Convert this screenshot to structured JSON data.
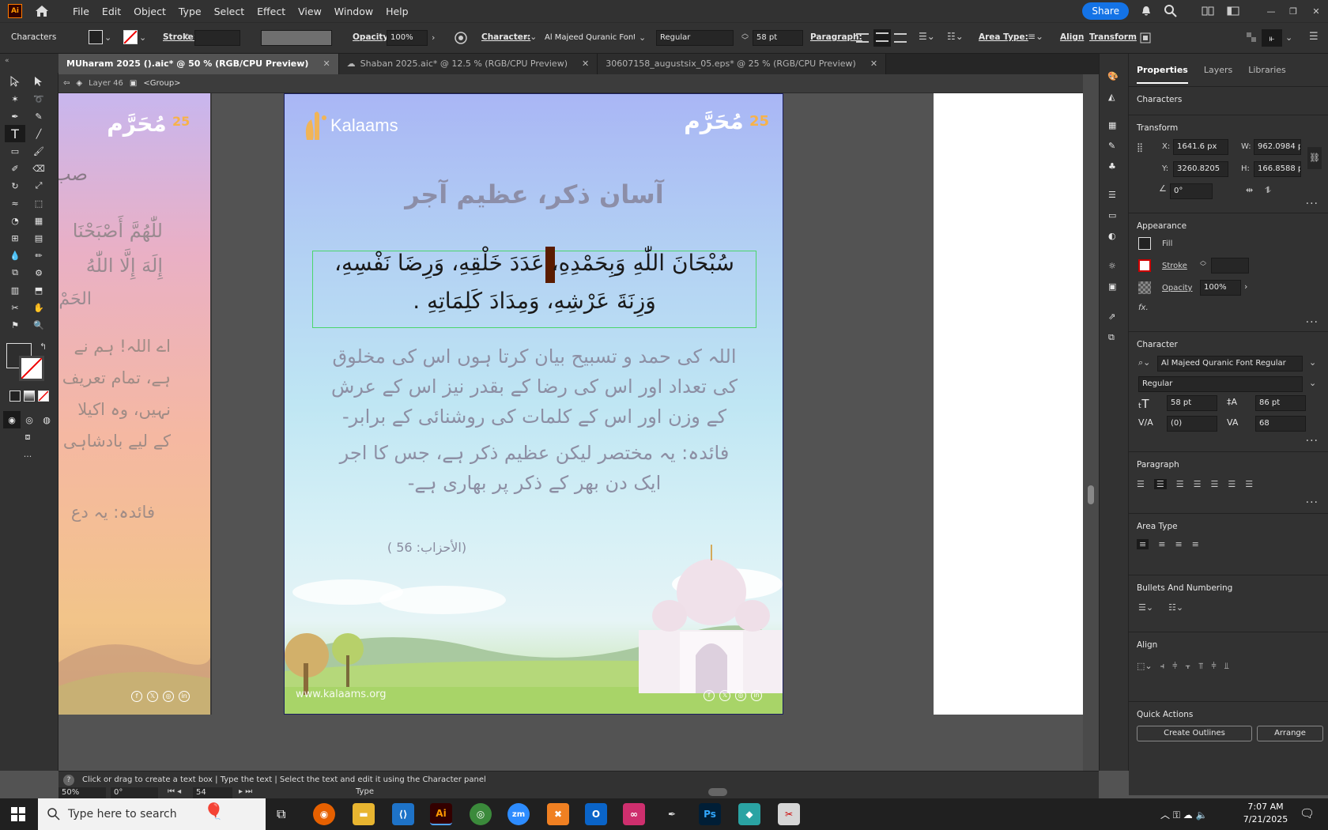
{
  "menubar": {
    "app_logo": "Ai",
    "items": [
      "File",
      "Edit",
      "Object",
      "Type",
      "Select",
      "Effect",
      "View",
      "Window",
      "Help"
    ],
    "share_label": "Share"
  },
  "control": {
    "panel_name": "Characters",
    "stroke_label": "Stroke:",
    "opacity_label": "Opacity:",
    "opacity_value": "100%",
    "character_label": "Character:",
    "font_name": "Al Majeed Quranic Font...",
    "font_style": "Regular",
    "font_size": "58 pt",
    "paragraph_label": "Paragraph:",
    "area_type_label": "Area Type:",
    "align_label": "Align",
    "transform_label": "Transform"
  },
  "tabs": [
    {
      "label": "MUharam 2025 ().aic* @ 50 % (RGB/CPU Preview)"
    },
    {
      "label": "Shaban 2025.aic* @ 12.5 % (RGB/CPU Preview)"
    },
    {
      "label": "30607158_augustsix_05.eps* @ 25 % (RGB/CPU Preview)"
    }
  ],
  "breadcrumb": {
    "layer": "Layer 46",
    "group": "<Group>"
  },
  "artboard": {
    "brand": "Kalaams",
    "badge_number": "25",
    "badge_arabic": "مُحَرَّم",
    "heading": "آسان ذکر، عظیم آجر",
    "arabic_line1": "سُبْحَانَ اللّٰهِ وَبِحَمْدِهِ، عَدَدَ خَلْقِهِ، وَرِضَا نَفْسِهِ،",
    "arabic_line2": "وَزِنَةَ عَرْشِهِ، وَمِدَادَ كَلِمَاتِهِ .",
    "urdu_line1": "اللہ کی حمد و تسبیح بیان کرتا ہوں اس کی مخلوق",
    "urdu_line2": "کی تعداد اور اس کی رضا کے بقدر نیز اس کے عرش",
    "urdu_line3": "کے وزن اور اس کے کلمات کی روشنائی کے برابر-",
    "benefit_line1": "فائدہ: یہ مختصر لیکن عظیم ذکر ہے، جس کا اجر",
    "benefit_line2": "ایک دن بھر کے ذکر پر بھاری ہے-",
    "reference": "(الأحزاب: 56 )",
    "website": "www.kalaams.org"
  },
  "left_artboard": {
    "line_a": "صب",
    "line_b": "للّٰهُمَّ أَصْبَحْنَا",
    "line_c": "إِلَهَ إِلَّا اللّٰهُ",
    "line_d": "الحَمْ",
    "line_e": "اے اللہ! ہم نے",
    "line_f": "ہے، تمام تعریف",
    "line_g": "نہیں، وہ اکیلا",
    "line_h": "کے لیے بادشاہی",
    "line_i": "فائدہ: یہ دع"
  },
  "properties": {
    "tabs": [
      "Properties",
      "Layers",
      "Libraries"
    ],
    "selection": "Characters",
    "transform": {
      "title": "Transform",
      "x_label": "X:",
      "x": "1641.6 px",
      "y_label": "Y:",
      "y": "3260.8205",
      "w_label": "W:",
      "w": "962.0984 p",
      "h_label": "H:",
      "h": "166.8588 p",
      "angle": "0°"
    },
    "appearance": {
      "title": "Appearance",
      "fill": "Fill",
      "stroke": "Stroke",
      "opacity_label": "Opacity",
      "opacity": "100%",
      "fx": "fx."
    },
    "character": {
      "title": "Character",
      "font": "Al Majeed Quranic Font Regular",
      "style": "Regular",
      "size": "58 pt",
      "leading": "86 pt",
      "kerning": "(0)",
      "tracking": "68"
    },
    "paragraph": {
      "title": "Paragraph"
    },
    "area_type": {
      "title": "Area Type"
    },
    "bullets": {
      "title": "Bullets And Numbering"
    },
    "align": {
      "title": "Align"
    },
    "quick_actions": {
      "title": "Quick Actions",
      "create_outlines": "Create Outlines",
      "arrange": "Arrange"
    }
  },
  "status": {
    "hint": "Click or drag to create a text box  |  Type the text  |  Select the text and edit it using the Character panel",
    "zoom": "50%",
    "rotation": "0°",
    "page": "54",
    "tool": "Type"
  },
  "taskbar": {
    "search_placeholder": "Type here to search",
    "time": "7:07 AM",
    "date": "7/21/2025"
  },
  "colors": {
    "accent": "#1473e6",
    "selection": "#4bd66b",
    "ui_dark": "#323232",
    "canvas": "#535353"
  }
}
